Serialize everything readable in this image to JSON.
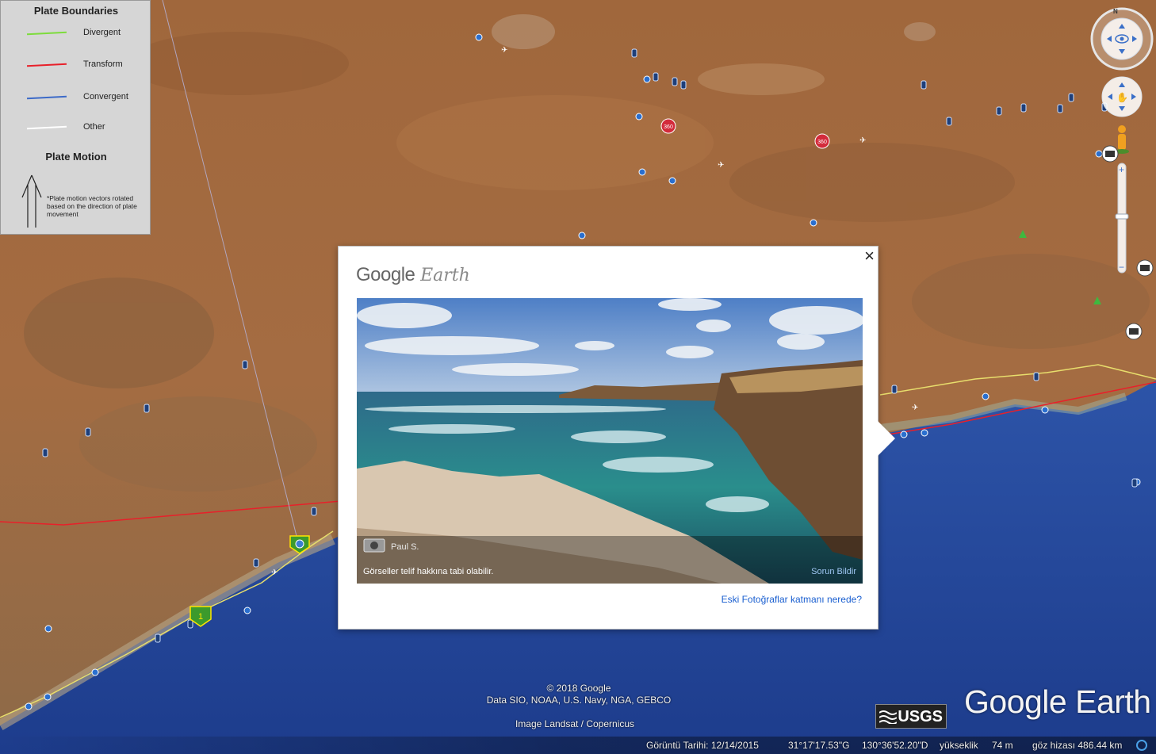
{
  "legend": {
    "title": "Plate Boundaries",
    "items": [
      {
        "label": "Divergent",
        "color": "#7ddc3c"
      },
      {
        "label": "Transform",
        "color": "#e8202a"
      },
      {
        "label": "Convergent",
        "color": "#3c6ac8"
      },
      {
        "label": "Other",
        "color": "#ffffff"
      }
    ],
    "motion_title": "Plate Motion",
    "motion_note": "*Plate motion vectors rotated based on the direction of plate movement"
  },
  "controls": {
    "compass_label": "N",
    "zoom_in": "+",
    "zoom_out": "−",
    "map_badge_360": "360",
    "route_marker": "1"
  },
  "popup": {
    "logo_main": "Google",
    "logo_sub": "Earth",
    "close": "×",
    "photo_credit": "Paul S.",
    "copyright": "Görseller telif hakkına tabi olabilir.",
    "report": "Sorun Bildir",
    "old_photos_link": "Eski Fotoğraflar katmanı nerede?"
  },
  "attribution": {
    "line1": "© 2018 Google",
    "line2": "Data SIO, NOAA, U.S. Navy, NGA, GEBCO",
    "imagery": "Image Landsat / Copernicus"
  },
  "branding": {
    "google_earth": "Google Earth",
    "usgs": "USGS"
  },
  "status": {
    "imagery_date": "Görüntü Tarihi: 12/14/2015",
    "lat": "31°17'17.53\"G",
    "lon": "130°36'52.20\"D",
    "elev_label": "yükseklik",
    "elev_value": "74 m",
    "eye_alt": "göz hizası 486.44 km"
  }
}
